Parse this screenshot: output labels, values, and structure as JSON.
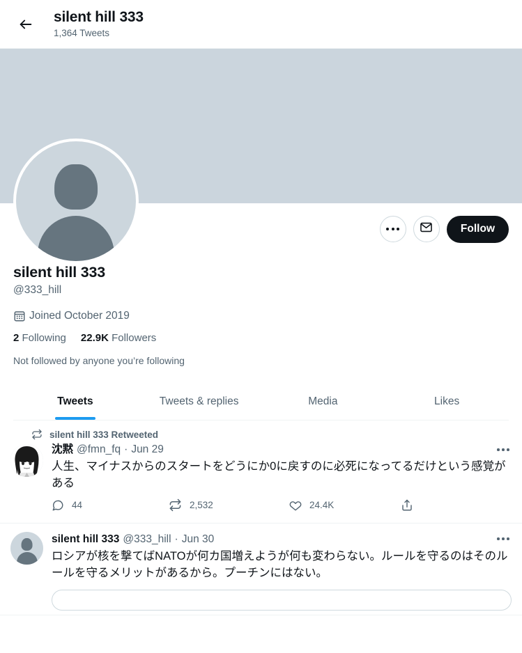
{
  "header": {
    "back_icon": "arrow-left-icon",
    "title": "silent hill 333",
    "tweet_count": "1,364 Tweets"
  },
  "profile": {
    "banner_color": "#cbd5dd",
    "avatar_icon": "default-avatar-icon",
    "display_name": "silent hill 333",
    "handle": "@333_hill",
    "joined_icon": "calendar-icon",
    "joined": "Joined October 2019",
    "following_count": "2",
    "following_label": "Following",
    "followers_count": "22.9K",
    "followers_label": "Followers",
    "not_followed": "Not followed by anyone you’re following",
    "more_icon": "more-horizontal-icon",
    "message_icon": "envelope-icon",
    "follow_label": "Follow",
    "follow_bg": "#0f1419"
  },
  "tabs": {
    "accent": "#1d9bf0",
    "items": [
      {
        "label": "Tweets",
        "active": true
      },
      {
        "label": "Tweets & replies",
        "active": false
      },
      {
        "label": "Media",
        "active": false
      },
      {
        "label": "Likes",
        "active": false
      }
    ]
  },
  "tweets": [
    {
      "retweet_icon": "retweet-icon",
      "retweet_context": "silent hill 333 Retweeted",
      "avatar_icon": "anime-portrait-avatar",
      "name": "沈黙",
      "handle": "@fmn_fq",
      "separator": "·",
      "date": "Jun 29",
      "text": "人生、マイナスからのスタートをどうにか0に戻すのに必死になってるだけという感覚がある",
      "more_icon": "more-horizontal-icon",
      "actions": {
        "reply_icon": "reply-icon",
        "reply_count": "44",
        "retweet_icon": "retweet-icon",
        "retweet_count": "2,532",
        "like_icon": "heart-icon",
        "like_count": "24.4K",
        "share_icon": "share-icon"
      }
    },
    {
      "retweet_context": "",
      "avatar_icon": "default-avatar-icon",
      "name": "silent hill 333",
      "handle": "@333_hill",
      "separator": "·",
      "date": "Jun 30",
      "text": "ロシアが核を撃てばNATOが何カ国増えようが何も変わらない。ルールを守るのはそのルールを守るメリットがあるから。プーチンにはない。",
      "more_icon": "more-horizontal-icon"
    }
  ]
}
